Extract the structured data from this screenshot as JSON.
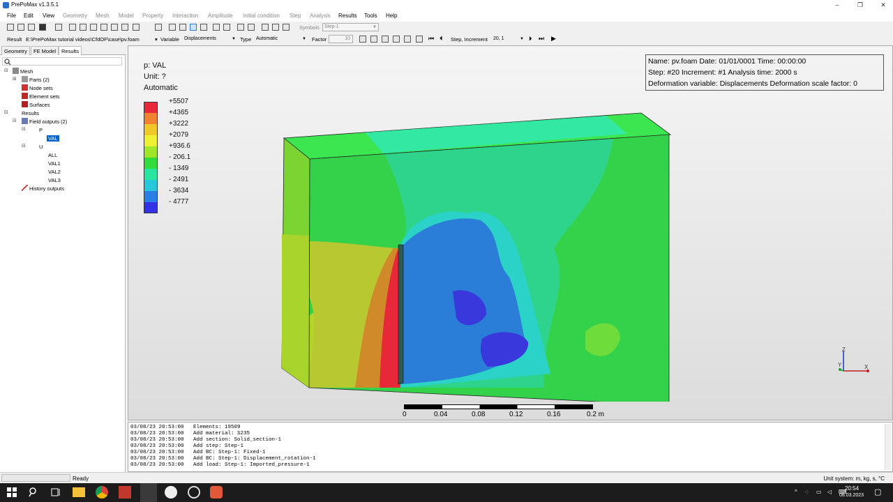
{
  "window": {
    "title": "PrePoMax v1.3.5.1"
  },
  "menu": [
    "File",
    "Edit",
    "View",
    "Geometry",
    "Mesh",
    "Model",
    "Property",
    "Interaction",
    "Amplitude",
    "Initial condition",
    "Step",
    "Analysis",
    "Results",
    "Tools",
    "Help"
  ],
  "menu_disabled": [
    false,
    false,
    false,
    true,
    true,
    true,
    true,
    true,
    true,
    true,
    true,
    true,
    false,
    false,
    false
  ],
  "toolbar1": {
    "symbols_label": "Symbols",
    "symbols_value": "Step-1"
  },
  "toolbar2": {
    "result_label": "Result",
    "result_path": "E:\\PrePoMax tutorial videos\\CfdOF\\case\\pv.foam",
    "variable_label": "Variable",
    "variable_value": "Displacements",
    "type_label": "Type",
    "type_value": "Automatic",
    "factor_label": "Factor",
    "factor_value": "10",
    "step_label": "Step, Increment",
    "step_value": "20, 1"
  },
  "tabs": [
    "Geometry",
    "FE Model",
    "Results"
  ],
  "active_tab": "Results",
  "tree": {
    "mesh": "Mesh",
    "parts": "Parts (2)",
    "node_sets": "Node sets",
    "element_sets": "Element sets",
    "surfaces": "Surfaces",
    "results": "Results",
    "field_outputs": "Field outputs (2)",
    "p": "P",
    "val": "VAL",
    "u": "U",
    "all": "ALL",
    "val1": "VAL1",
    "val2": "VAL2",
    "val3": "VAL3",
    "history_outputs": "History outputs"
  },
  "legend": {
    "title": "p: VAL",
    "unit": "Unit: ?",
    "mode": "Automatic",
    "labels": [
      "+5507",
      "+4365",
      "+3222",
      "+2079",
      "+936.6",
      "- 206.1",
      "- 1349",
      "- 2491",
      "- 3634",
      "- 4777"
    ],
    "colors": [
      "#e8283a",
      "#f08232",
      "#f0c828",
      "#f0f032",
      "#a0e628",
      "#32dc3c",
      "#28e6a0",
      "#28c8dc",
      "#2880e6",
      "#3232e6"
    ]
  },
  "info": {
    "line1": "Name: pv.foam   Date: 01/01/0001   Time: 00:00:00",
    "line2": "Step: #20   Increment: #1   Analysis time: 2000 s",
    "line3": "Deformation variable: Displacements   Deformation scale factor: 0"
  },
  "scale_bar": {
    "ticks": [
      "0",
      "0.04",
      "0.08",
      "0.12",
      "0.16",
      "0.2 m"
    ]
  },
  "triad": {
    "x": "X",
    "y": "Y",
    "z": "Z"
  },
  "console": [
    "03/08/23 20:53:00   Elements: 19509",
    "03/08/23 20:53:00   Add material: S235",
    "03/08/23 20:53:00   Add section: Solid_section-1",
    "03/08/23 20:53:00   Add step: Step-1",
    "03/08/23 20:53:00   Add BC: Step-1: Fixed-1",
    "03/08/23 20:53:00   Add BC: Step-1: Displacement_rotation-1",
    "03/08/23 20:53:00   Add load: Step-1: Imported_pressure-1"
  ],
  "status": {
    "left": "Ready",
    "right": "Unit system: m, kg, s, °C"
  },
  "taskbar": {
    "time": "20:54",
    "date": "08.03.2023"
  }
}
